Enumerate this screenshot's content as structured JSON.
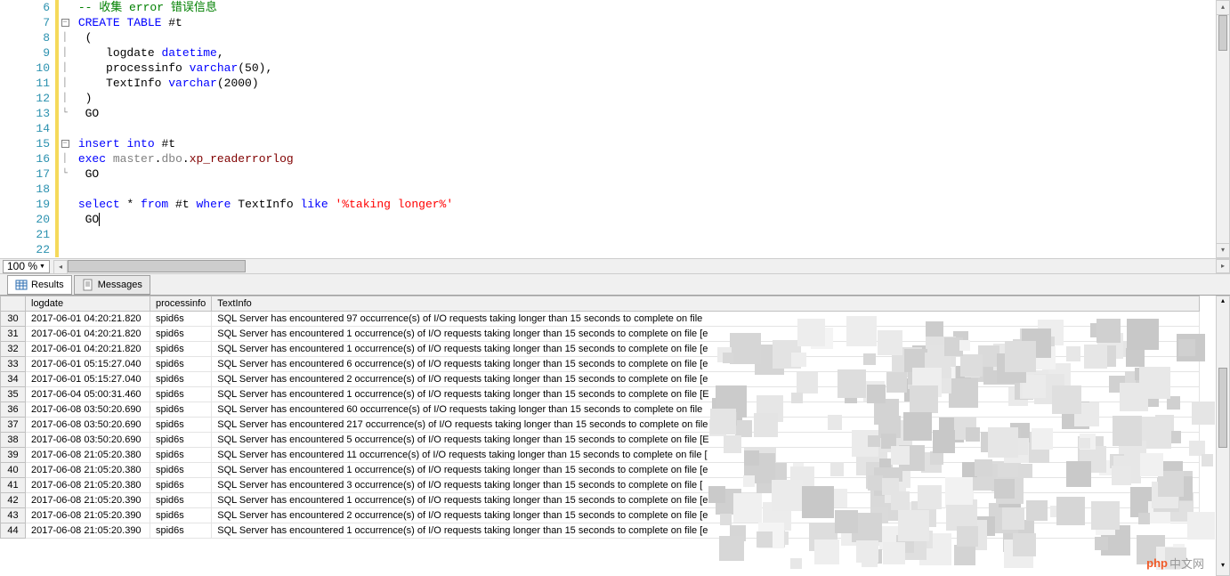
{
  "zoom": "100 %",
  "tabs": {
    "results": "Results",
    "messages": "Messages"
  },
  "code": {
    "lines": [
      {
        "n": 6,
        "fold": "",
        "tokens": [
          {
            "c": "tok-comment",
            "t": "-- 收集 error 错误信息"
          }
        ]
      },
      {
        "n": 7,
        "fold": "minus",
        "tokens": [
          {
            "c": "tok-kw",
            "t": "CREATE"
          },
          {
            "c": "tok-plain",
            "t": " "
          },
          {
            "c": "tok-kw",
            "t": "TABLE"
          },
          {
            "c": "tok-plain",
            "t": " #t"
          }
        ]
      },
      {
        "n": 8,
        "fold": "bar",
        "tokens": [
          {
            "c": "tok-plain",
            "t": " ("
          }
        ]
      },
      {
        "n": 9,
        "fold": "bar",
        "tokens": [
          {
            "c": "tok-plain",
            "t": "    logdate "
          },
          {
            "c": "tok-kw",
            "t": "datetime"
          },
          {
            "c": "tok-plain",
            "t": ","
          }
        ]
      },
      {
        "n": 10,
        "fold": "bar",
        "tokens": [
          {
            "c": "tok-plain",
            "t": "    processinfo "
          },
          {
            "c": "tok-kw",
            "t": "varchar"
          },
          {
            "c": "tok-plain",
            "t": "(50),"
          }
        ]
      },
      {
        "n": 11,
        "fold": "bar",
        "tokens": [
          {
            "c": "tok-plain",
            "t": "    TextInfo "
          },
          {
            "c": "tok-kw",
            "t": "varchar"
          },
          {
            "c": "tok-plain",
            "t": "(2000)"
          }
        ]
      },
      {
        "n": 12,
        "fold": "bar",
        "tokens": [
          {
            "c": "tok-plain",
            "t": " )"
          }
        ]
      },
      {
        "n": 13,
        "fold": "end",
        "tokens": [
          {
            "c": "tok-plain",
            "t": " GO"
          }
        ]
      },
      {
        "n": 14,
        "fold": "",
        "tokens": [
          {
            "c": "tok-plain",
            "t": ""
          }
        ]
      },
      {
        "n": 15,
        "fold": "minus",
        "tokens": [
          {
            "c": "tok-kw",
            "t": "insert"
          },
          {
            "c": "tok-plain",
            "t": " "
          },
          {
            "c": "tok-kw",
            "t": "into"
          },
          {
            "c": "tok-plain",
            "t": " #t"
          }
        ]
      },
      {
        "n": 16,
        "fold": "bar",
        "tokens": [
          {
            "c": "tok-kw",
            "t": "exec"
          },
          {
            "c": "tok-plain",
            "t": " "
          },
          {
            "c": "tok-func",
            "t": "master"
          },
          {
            "c": "tok-plain",
            "t": "."
          },
          {
            "c": "tok-func",
            "t": "dbo"
          },
          {
            "c": "tok-plain",
            "t": "."
          },
          {
            "c": "tok-sp",
            "t": "xp_readerrorlog"
          }
        ]
      },
      {
        "n": 17,
        "fold": "end",
        "tokens": [
          {
            "c": "tok-plain",
            "t": " GO"
          }
        ]
      },
      {
        "n": 18,
        "fold": "",
        "tokens": [
          {
            "c": "tok-plain",
            "t": ""
          }
        ]
      },
      {
        "n": 19,
        "fold": "",
        "tokens": [
          {
            "c": "tok-kw",
            "t": "select"
          },
          {
            "c": "tok-plain",
            "t": " * "
          },
          {
            "c": "tok-kw",
            "t": "from"
          },
          {
            "c": "tok-plain",
            "t": " #t "
          },
          {
            "c": "tok-kw",
            "t": "where"
          },
          {
            "c": "tok-plain",
            "t": " TextInfo "
          },
          {
            "c": "tok-kw",
            "t": "like"
          },
          {
            "c": "tok-plain",
            "t": " "
          },
          {
            "c": "tok-str",
            "t": "'%taking longer%'"
          }
        ]
      },
      {
        "n": 20,
        "fold": "",
        "tokens": [
          {
            "c": "tok-plain",
            "t": " GO"
          }
        ],
        "cursor": true
      },
      {
        "n": 21,
        "fold": "",
        "tokens": [
          {
            "c": "tok-plain",
            "t": ""
          }
        ]
      },
      {
        "n": 22,
        "fold": "",
        "tokens": [
          {
            "c": "tok-plain",
            "t": ""
          }
        ]
      }
    ]
  },
  "grid": {
    "columns": [
      "",
      "logdate",
      "processinfo",
      "TextInfo"
    ],
    "rows": [
      {
        "n": "30",
        "logdate": "2017-06-01 04:20:21.820",
        "processinfo": "spid6s",
        "textinfo": "SQL Server has encountered 97 occurrence(s) of I/O requests taking longer than 15 seconds to complete on file "
      },
      {
        "n": "31",
        "logdate": "2017-06-01 04:20:21.820",
        "processinfo": "spid6s",
        "textinfo": "SQL Server has encountered 1 occurrence(s) of I/O requests taking longer than 15 seconds to complete on file [e"
      },
      {
        "n": "32",
        "logdate": "2017-06-01 04:20:21.820",
        "processinfo": "spid6s",
        "textinfo": "SQL Server has encountered 1 occurrence(s) of I/O requests taking longer than 15 seconds to complete on file [e"
      },
      {
        "n": "33",
        "logdate": "2017-06-01 05:15:27.040",
        "processinfo": "spid6s",
        "textinfo": "SQL Server has encountered 6 occurrence(s) of I/O requests taking longer than 15 seconds to complete on file [e"
      },
      {
        "n": "34",
        "logdate": "2017-06-01 05:15:27.040",
        "processinfo": "spid6s",
        "textinfo": "SQL Server has encountered 2 occurrence(s) of I/O requests taking longer than 15 seconds to complete on file [e"
      },
      {
        "n": "35",
        "logdate": "2017-06-04 05:00:31.460",
        "processinfo": "spid6s",
        "textinfo": "SQL Server has encountered 1 occurrence(s) of I/O requests taking longer than 15 seconds to complete on file [E"
      },
      {
        "n": "36",
        "logdate": "2017-06-08 03:50:20.690",
        "processinfo": "spid6s",
        "textinfo": "SQL Server has encountered 60 occurrence(s) of I/O requests taking longer than 15 seconds to complete on file "
      },
      {
        "n": "37",
        "logdate": "2017-06-08 03:50:20.690",
        "processinfo": "spid6s",
        "textinfo": "SQL Server has encountered 217 occurrence(s) of I/O requests taking longer than 15 seconds to complete on file "
      },
      {
        "n": "38",
        "logdate": "2017-06-08 03:50:20.690",
        "processinfo": "spid6s",
        "textinfo": "SQL Server has encountered 5 occurrence(s) of I/O requests taking longer than 15 seconds to complete on file [E"
      },
      {
        "n": "39",
        "logdate": "2017-06-08 21:05:20.380",
        "processinfo": "spid6s",
        "textinfo": "SQL Server has encountered 11 occurrence(s) of I/O requests taking longer than 15 seconds to complete on file ["
      },
      {
        "n": "40",
        "logdate": "2017-06-08 21:05:20.380",
        "processinfo": "spid6s",
        "textinfo": "SQL Server has encountered 1 occurrence(s) of I/O requests taking longer than 15 seconds to complete on file [e"
      },
      {
        "n": "41",
        "logdate": "2017-06-08 21:05:20.380",
        "processinfo": "spid6s",
        "textinfo": "SQL Server has encountered 3 occurrence(s) of I/O requests taking longer than 15 seconds to complete on file ["
      },
      {
        "n": "42",
        "logdate": "2017-06-08 21:05:20.390",
        "processinfo": "spid6s",
        "textinfo": "SQL Server has encountered 1 occurrence(s) of I/O requests taking longer than 15 seconds to complete on file [e:"
      },
      {
        "n": "43",
        "logdate": "2017-06-08 21:05:20.390",
        "processinfo": "spid6s",
        "textinfo": "SQL Server has encountered 2 occurrence(s) of I/O requests taking longer than 15 seconds to complete on file [e"
      },
      {
        "n": "44",
        "logdate": "2017-06-08 21:05:20.390",
        "processinfo": "spid6s",
        "textinfo": "SQL Server has encountered 1 occurrence(s) of I/O requests taking longer than 15 seconds to complete on file [e"
      }
    ]
  },
  "watermark": {
    "brand": "php",
    "suffix": "中文网"
  }
}
